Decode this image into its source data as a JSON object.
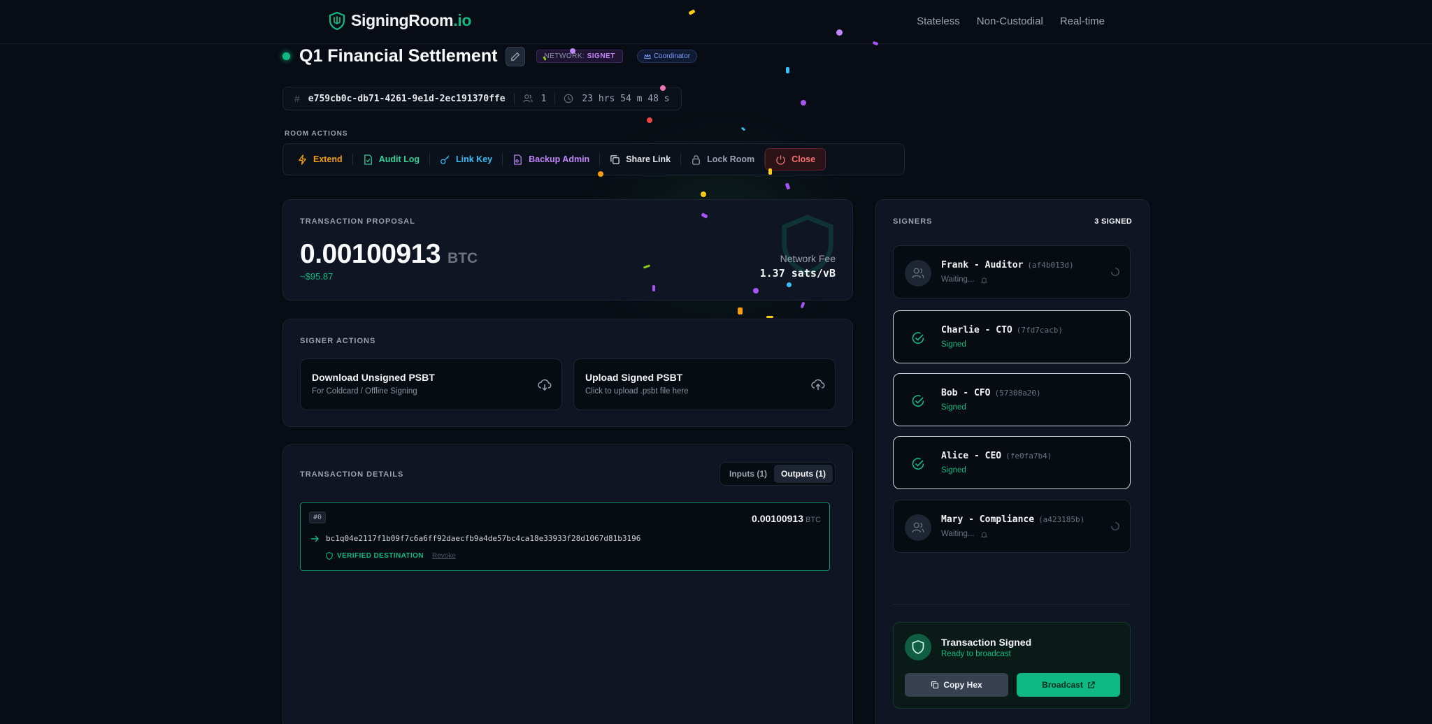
{
  "header": {
    "brand_name": "SigningRoom",
    "brand_tld": ".io",
    "nav": [
      "Stateless",
      "Non-Custodial",
      "Real-time"
    ]
  },
  "room": {
    "title": "Q1 Financial Settlement",
    "network_label": "NETWORK:",
    "network_value": "SIGNET",
    "role_badge": "Coordinator",
    "id": "e759cb0c-db71-4261-9e1d-2ec191370ffe",
    "participants": "1",
    "time_remaining": "23 hrs 54 m 48 s"
  },
  "room_actions": {
    "label": "ROOM ACTIONS",
    "items": [
      "Extend",
      "Audit Log",
      "Link Key",
      "Backup Admin",
      "Share Link",
      "Lock Room",
      "Close"
    ]
  },
  "proposal": {
    "label": "TRANSACTION PROPOSAL",
    "amount": "0.00100913",
    "unit": "BTC",
    "fiat": "~$95.87",
    "fee_label": "Network Fee",
    "fee_value": "1.37 sats/vB"
  },
  "signer_actions": {
    "label": "SIGNER ACTIONS",
    "download_title": "Download Unsigned PSBT",
    "download_sub": "For Coldcard / Offline Signing",
    "upload_title": "Upload Signed PSBT",
    "upload_sub": "Click to upload .psbt file here"
  },
  "tx_details": {
    "label": "TRANSACTION DETAILS",
    "tabs": [
      "Inputs (1)",
      "Outputs (1)"
    ],
    "active_tab": "Outputs (1)",
    "outputs": [
      {
        "index": "#0",
        "amount": "0.00100913",
        "unit": "BTC",
        "address": "bc1q04e2117f1b09f7c6a6ff92daecfb9a4de57bc4ca18e33933f28d1067d81b3196",
        "verified_label": "VERIFIED DESTINATION",
        "revoke_label": "Revoke"
      }
    ]
  },
  "signers": {
    "label": "SIGNERS",
    "count_label": "3 SIGNED",
    "list": [
      {
        "name": "Frank - Auditor",
        "key": "(af4b013d)",
        "status": "Waiting...",
        "signed": false
      },
      {
        "name": "Charlie - CTO",
        "key": "(7fd7cacb)",
        "status": "Signed",
        "signed": true
      },
      {
        "name": "Bob - CFO",
        "key": "(57308a20)",
        "status": "Signed",
        "signed": true
      },
      {
        "name": "Alice - CEO",
        "key": "(fe0fa7b4)",
        "status": "Signed",
        "signed": true
      },
      {
        "name": "Mary - Compliance",
        "key": "(a423185b)",
        "status": "Waiting...",
        "signed": false
      }
    ]
  },
  "signed_panel": {
    "title": "Transaction Signed",
    "subtitle": "Ready to broadcast",
    "copy_label": "Copy Hex",
    "broadcast_label": "Broadcast"
  },
  "colors": {
    "accent": "#10b981",
    "warning": "#f59e0b",
    "danger": "#f87171",
    "purple": "#c084fc",
    "sky": "#38bdf8"
  }
}
